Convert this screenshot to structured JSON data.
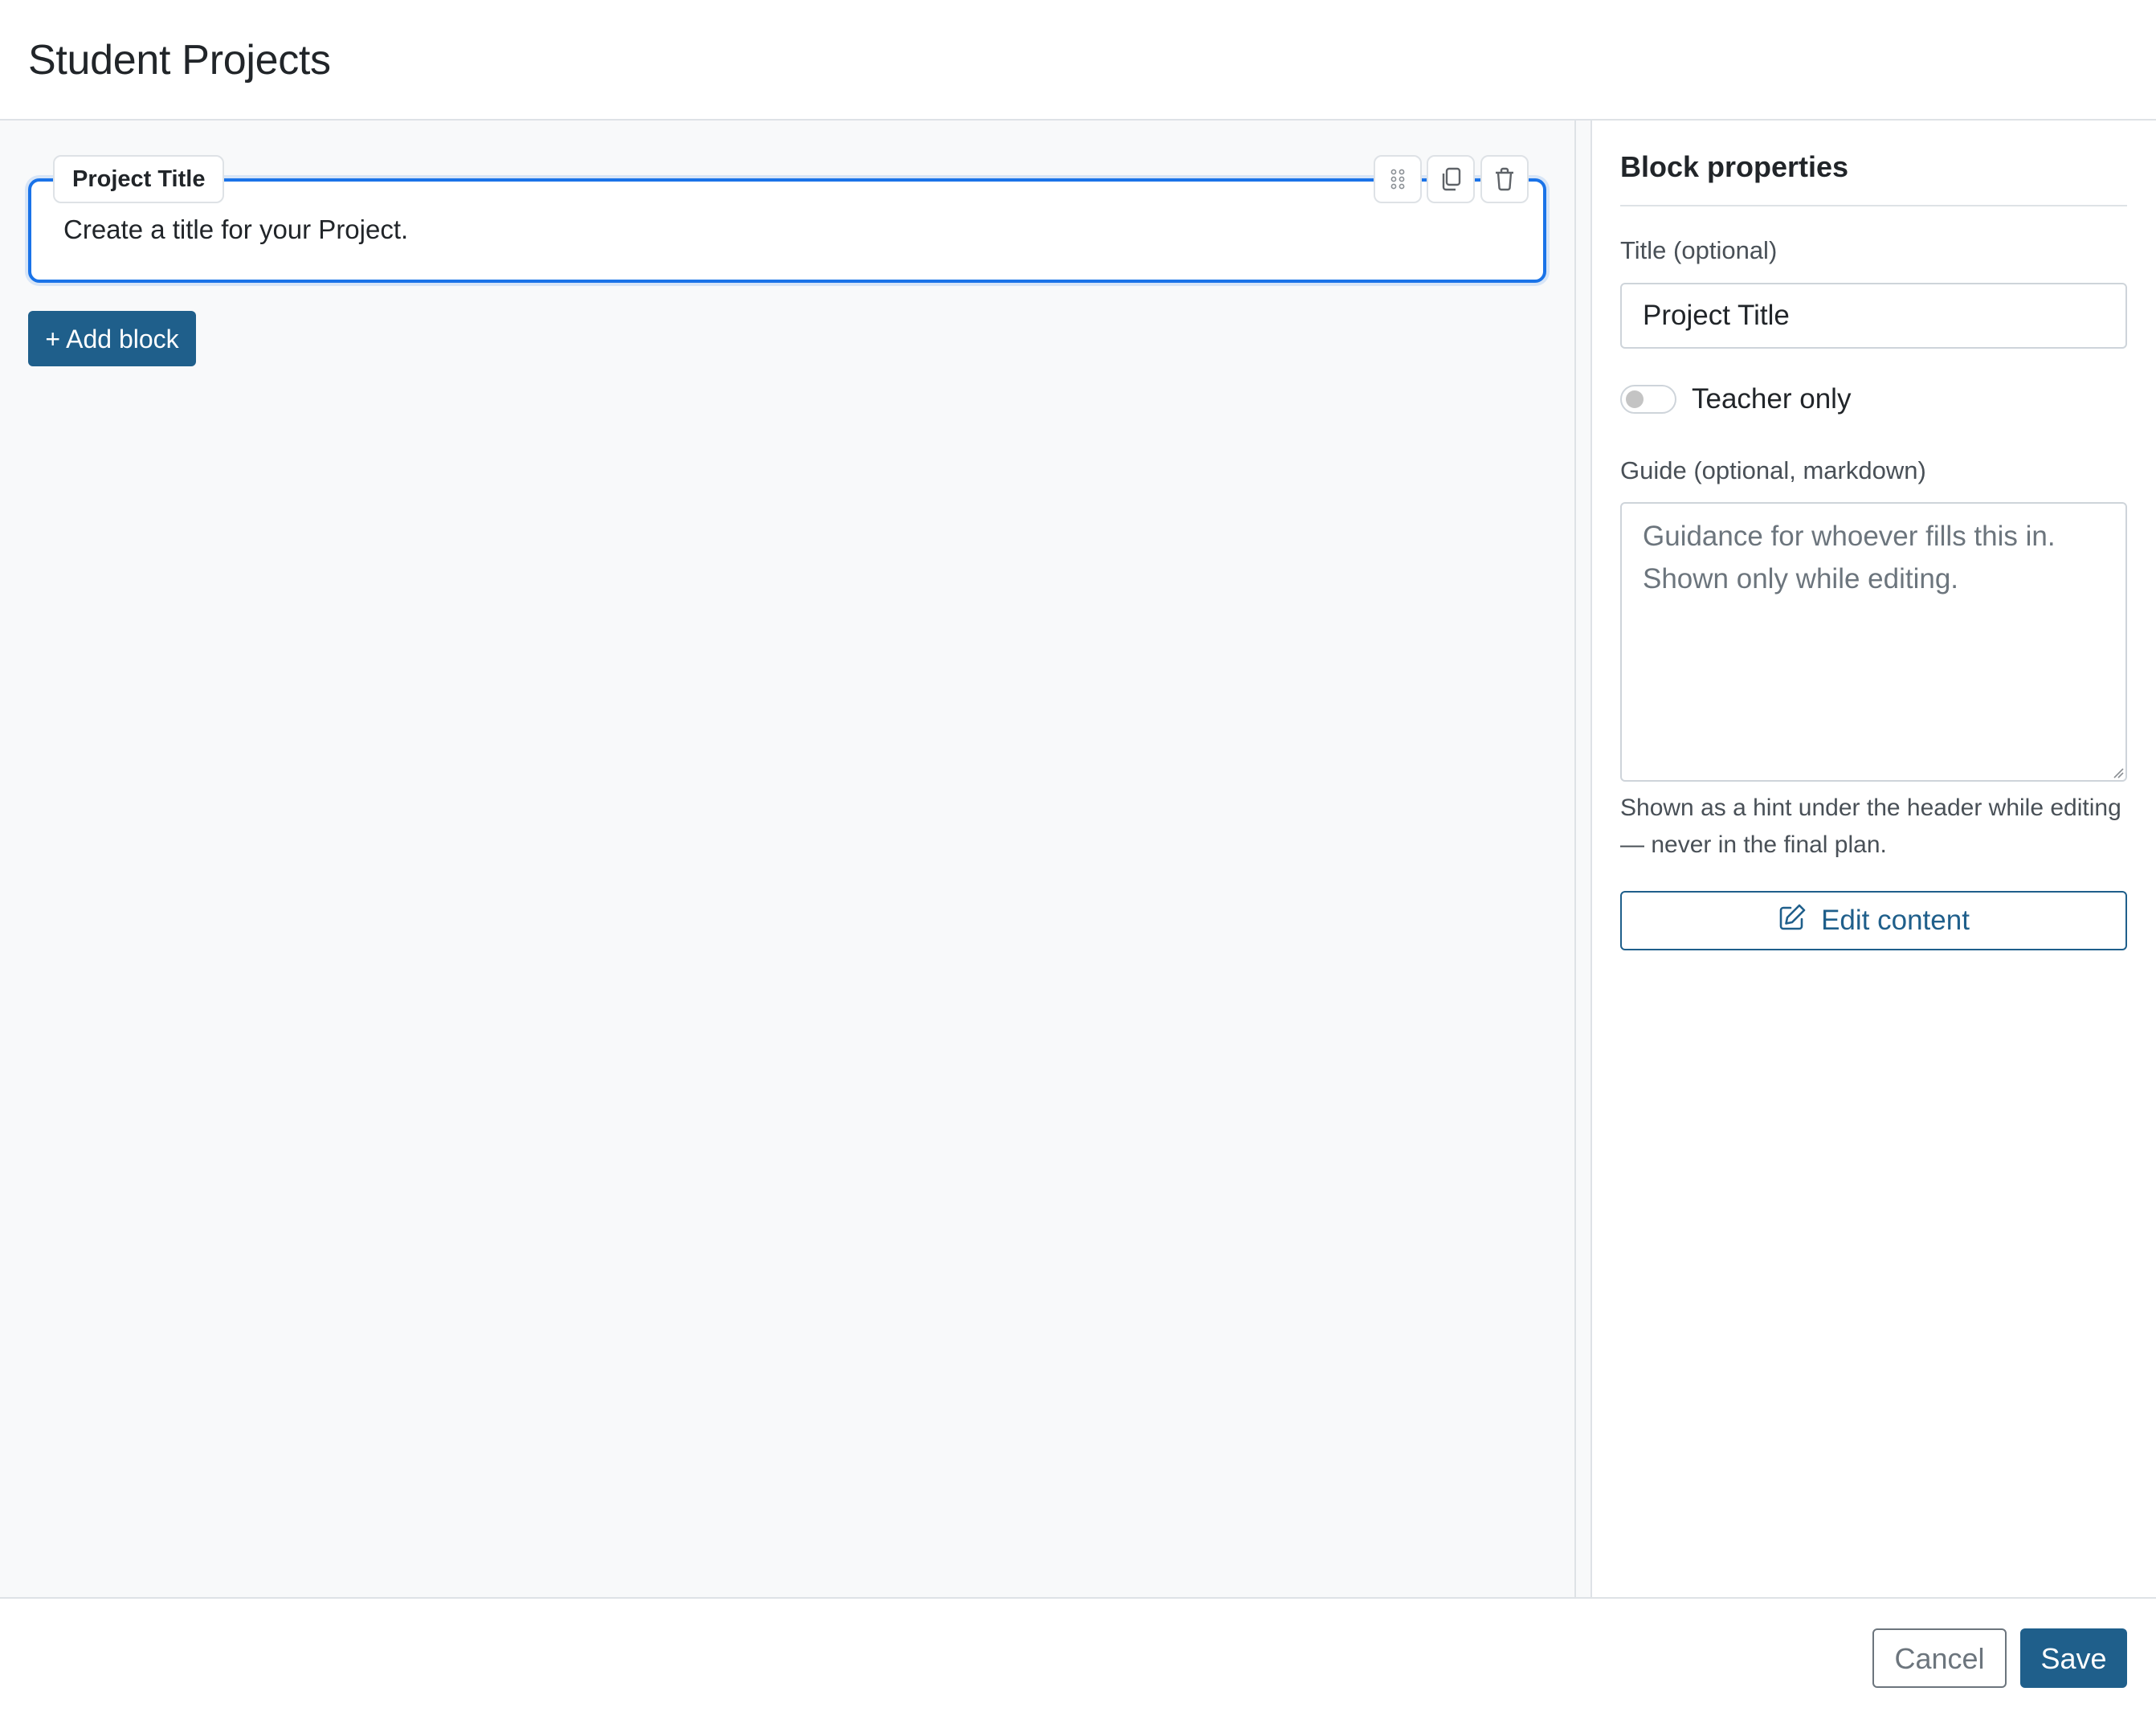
{
  "header": {
    "title": "Student Projects"
  },
  "canvas": {
    "block": {
      "label": "Project Title",
      "text": "Create a title for your Project.",
      "tools": [
        "drag-handle-icon",
        "duplicate-icon",
        "trash-icon"
      ]
    },
    "add_block_label": "+ Add block"
  },
  "properties": {
    "heading": "Block properties",
    "title_label": "Title (optional)",
    "title_value": "Project Title",
    "teacher_only_label": "Teacher only",
    "teacher_only_on": false,
    "guide_label": "Guide (optional, markdown)",
    "guide_placeholder": "Guidance for whoever fills this in.\nShown only while editing.",
    "guide_help": "Shown as a hint under the header while editing — never in the final plan.",
    "edit_content_label": "Edit content",
    "edit_content_icon": "pencil-square-icon"
  },
  "footer": {
    "cancel_label": "Cancel",
    "save_label": "Save"
  },
  "colors": {
    "accent": "#1f5f8b",
    "selection": "#1a73e8",
    "canvas_bg": "#f8f9fa",
    "border": "#dee2e6"
  }
}
